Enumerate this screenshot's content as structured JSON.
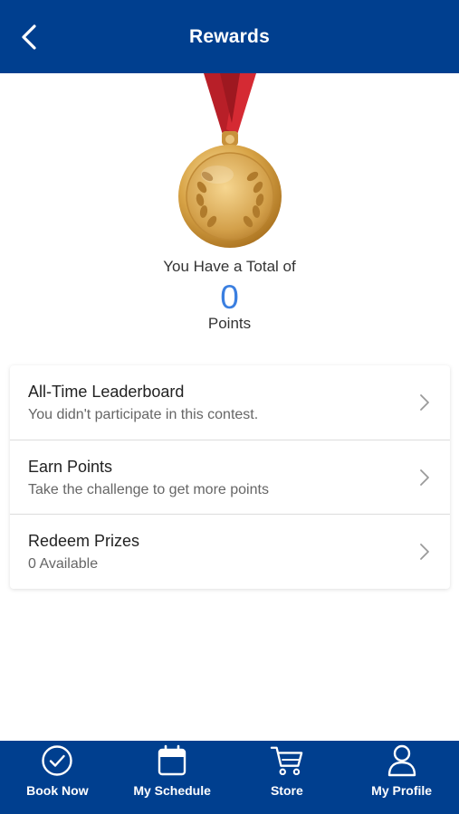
{
  "header": {
    "title": "Rewards",
    "back_icon": "chevron-left-icon"
  },
  "summary": {
    "total_text": "You Have a Total of",
    "points": "0",
    "points_label": "Points",
    "medal_icon": "gold-medal-icon"
  },
  "menu": [
    {
      "title": "All-Time Leaderboard",
      "subtitle": "You didn't participate in this contest."
    },
    {
      "title": "Earn Points",
      "subtitle": "Take the challenge to get more points"
    },
    {
      "title": "Redeem Prizes",
      "subtitle": "0 Available"
    }
  ],
  "tabs": [
    {
      "label": "Book Now",
      "icon": "check-circle-icon"
    },
    {
      "label": "My Schedule",
      "icon": "calendar-icon"
    },
    {
      "label": "Store",
      "icon": "cart-icon"
    },
    {
      "label": "My Profile",
      "icon": "user-icon"
    }
  ],
  "colors": {
    "primary": "#003f8f",
    "points_accent": "#3b7fe0",
    "ribbon": "#c0232c",
    "medal_gold": "#d9a548"
  }
}
